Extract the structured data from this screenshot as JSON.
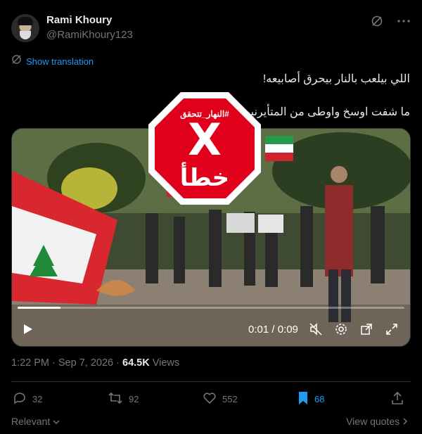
{
  "author": {
    "name": "Rami Khoury",
    "handle": "@RamiKhoury123"
  },
  "translate": {
    "label": "Show translation"
  },
  "tweet": {
    "line1": "اللي بيلعب بالنار بيحرق أصابيعه!",
    "line2": "ما شفت اوسخ واوطى من المتأيرنين"
  },
  "video": {
    "time": "0:01 / 0:09",
    "progress": 0.11
  },
  "stamp": {
    "tag": "#النهار_تتحقق",
    "mark": "X",
    "word": "خطأ"
  },
  "meta": {
    "time": "1:22 PM",
    "sep": " · ",
    "date": "Sep 7, 2026",
    "sep2": " · ",
    "views": "64.5K",
    "views_label": " Views"
  },
  "actions": {
    "replies": "32",
    "reposts": "92",
    "likes": "552",
    "bookmarks": "68"
  },
  "footer": {
    "relevant": "Relevant",
    "view_quotes": "View quotes"
  },
  "colors": {
    "accent": "#1d9bf0",
    "stamp_red": "#e0001b",
    "background": "#000000"
  }
}
